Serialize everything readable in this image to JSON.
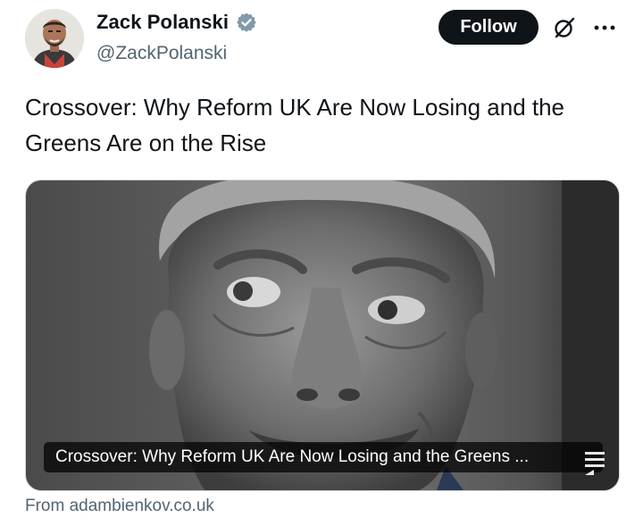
{
  "author": {
    "name": "Zack Polanski",
    "handle": "@ZackPolanski",
    "verified": true
  },
  "actions": {
    "follow_label": "Follow",
    "grok_icon": "grok-icon",
    "more_icon": "more-horizontal-icon"
  },
  "tweet": {
    "text": "Crossover: Why Reform UK Are Now Losing and the Greens Are on the Rise"
  },
  "card": {
    "caption": "Crossover: Why Reform UK Are Now Losing and the Greens ...",
    "source": "From adambienkov.co.uk"
  },
  "colors": {
    "verified_badge": "#829aab",
    "follow_bg": "#0f1419",
    "secondary_text": "#536471"
  }
}
